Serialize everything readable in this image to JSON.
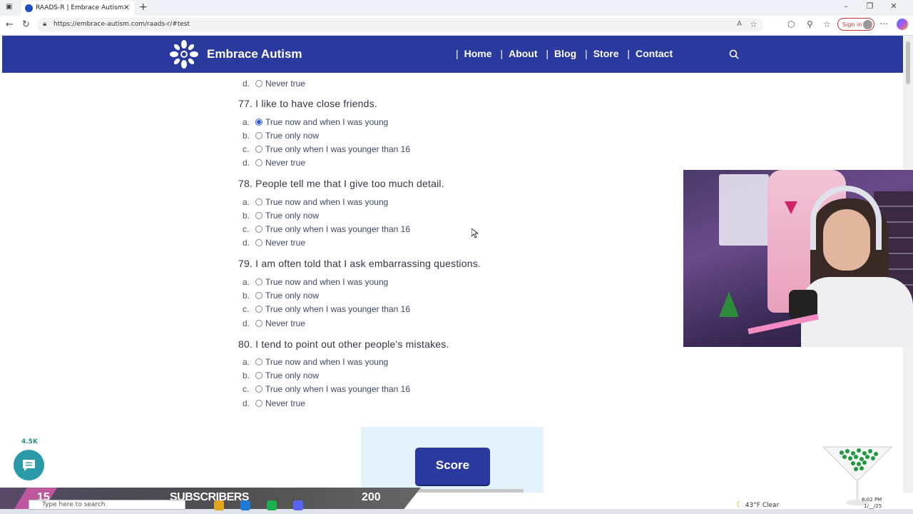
{
  "browser": {
    "tab_title": "RAADS-R | Embrace Autism",
    "url": "https://embrace-autism.com/raads-r/#test",
    "signin_label": "Sign in",
    "icons": [
      "back-icon",
      "refresh-icon",
      "lock-icon",
      "read-aloud-icon",
      "favorite-icon",
      "extensions-icon",
      "collections-icon",
      "favorites-bar-icon",
      "more-icon",
      "copilot-icon"
    ]
  },
  "site": {
    "brand": "Embrace Autism",
    "nav": [
      "Home",
      "About",
      "Blog",
      "Store",
      "Contact"
    ],
    "active_nav": "Blog",
    "colors": {
      "header": "#2a3a9e",
      "accent": "#2a5bd7",
      "score_panel": "#e4f3fb"
    }
  },
  "quiz": {
    "partial_option": {
      "letter": "d.",
      "text": "Never true"
    },
    "questions": [
      {
        "number": "77.",
        "text": "I like to have close friends.",
        "selected": 0,
        "options": [
          {
            "letter": "a.",
            "text": "True now and when I was young"
          },
          {
            "letter": "b.",
            "text": "True only now"
          },
          {
            "letter": "c.",
            "text": "True only when I was younger than 16"
          },
          {
            "letter": "d.",
            "text": "Never true"
          }
        ]
      },
      {
        "number": "78.",
        "text": "People tell me that I give too much detail.",
        "selected": null,
        "options": [
          {
            "letter": "a.",
            "text": "True now and when I was young"
          },
          {
            "letter": "b.",
            "text": "True only now"
          },
          {
            "letter": "c.",
            "text": "True only when I was younger than 16"
          },
          {
            "letter": "d.",
            "text": "Never true"
          }
        ]
      },
      {
        "number": "79.",
        "text": "I am often told that I ask embarrassing questions.",
        "selected": null,
        "options": [
          {
            "letter": "a.",
            "text": "True now and when I was young"
          },
          {
            "letter": "b.",
            "text": "True only now"
          },
          {
            "letter": "c.",
            "text": "True only when I was younger than 16"
          },
          {
            "letter": "d.",
            "text": "Never true"
          }
        ]
      },
      {
        "number": "80.",
        "text": "I tend to point out other people's mistakes.",
        "selected": null,
        "options": [
          {
            "letter": "a.",
            "text": "True now and when I was young"
          },
          {
            "letter": "b.",
            "text": "True only now"
          },
          {
            "letter": "c.",
            "text": "True only when I was younger than 16"
          },
          {
            "letter": "d.",
            "text": "Never true"
          }
        ]
      }
    ],
    "score_label": "Score"
  },
  "chat": {
    "count": "4.5K"
  },
  "stream_overlay": {
    "left_count": "15",
    "label": "SUBSCRIBERS",
    "goal": "200"
  },
  "taskbar": {
    "search_placeholder": "Type here to search",
    "weather": "43°F  Clear",
    "time": "6:02 PM",
    "date": "1/__/25"
  }
}
